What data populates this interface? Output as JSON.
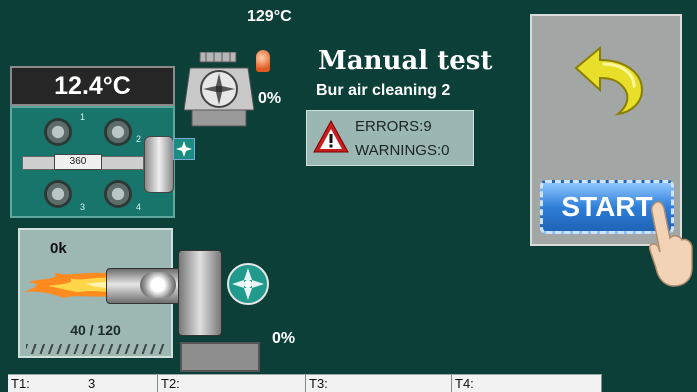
{
  "screen": {
    "title": "Manual test",
    "subtitle": "Bur air cleaning 2"
  },
  "boiler": {
    "temperature": "12.4°C",
    "setpoint": "360",
    "gauges": [
      {
        "num": "1"
      },
      {
        "num": "2"
      },
      {
        "num": "3"
      },
      {
        "num": "4"
      }
    ]
  },
  "exhaust": {
    "flue_temp": "129°C",
    "fan_percent": "0%"
  },
  "alerts": {
    "errors": "ERRORS:9",
    "warnings": "WARNINGS:0"
  },
  "burner": {
    "power": "0k",
    "fuel": "40 / 120",
    "feeder_percent": "0%"
  },
  "controls": {
    "start_label": "START"
  },
  "bottom_bar": [
    {
      "label": "T1:",
      "value": "3"
    },
    {
      "label": "T2:",
      "value": ""
    },
    {
      "label": "T3:",
      "value": ""
    },
    {
      "label": "T4:",
      "value": ""
    }
  ],
  "colors": {
    "background": "#0c3f38",
    "panel_teal": "#18756c",
    "start_blue": "#2f7ed8",
    "back_arrow_yellow": "#e8df2a",
    "flame_orange": "#ff8a1f"
  },
  "icons": [
    "fan-icon",
    "warning-triangle-icon",
    "back-arrow-icon",
    "pointing-hand-icon",
    "flame-icon",
    "thermometer-bulb-icon"
  ]
}
